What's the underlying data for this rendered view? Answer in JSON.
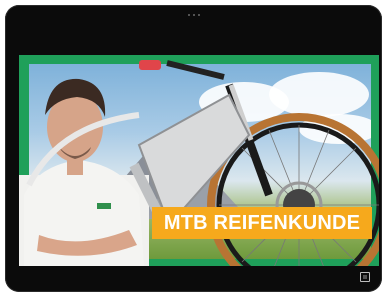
{
  "video": {
    "title_overlay": "MTB REIFENKUNDE",
    "colors": {
      "frame": "#1fa05a",
      "banner": "#f6a91c",
      "bezel": "#0b0b0b"
    }
  },
  "controls": {
    "fullscreen_icon": "fullscreen-icon"
  }
}
